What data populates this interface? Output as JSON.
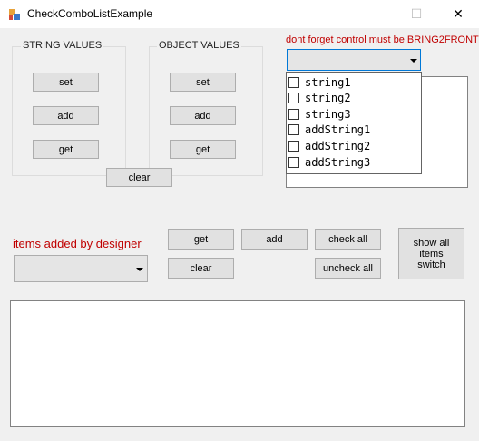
{
  "window": {
    "title": "CheckComboListExample",
    "minimize": "—",
    "maximize": "☐",
    "close": "✕"
  },
  "string_group": {
    "legend": "STRING VALUES",
    "set": "set",
    "add": "add",
    "get": "get"
  },
  "object_group": {
    "legend": "OBJECT VALUES",
    "set": "set",
    "add": "add",
    "get": "get"
  },
  "clear_top": "clear",
  "warning_label": "dont forget control must be BRING2FRONT",
  "dropdown_items": [
    "string1",
    "string2",
    "string3",
    "addString1",
    "addString2",
    "addString3"
  ],
  "designer_label": "items added by designer",
  "buttons": {
    "get": "get",
    "add": "add",
    "check_all": "check all",
    "clear": "clear",
    "uncheck_all": "uncheck all",
    "show_all": "show all items switch"
  },
  "colors": {
    "warning": "#c00000",
    "focus": "#0078d7"
  }
}
